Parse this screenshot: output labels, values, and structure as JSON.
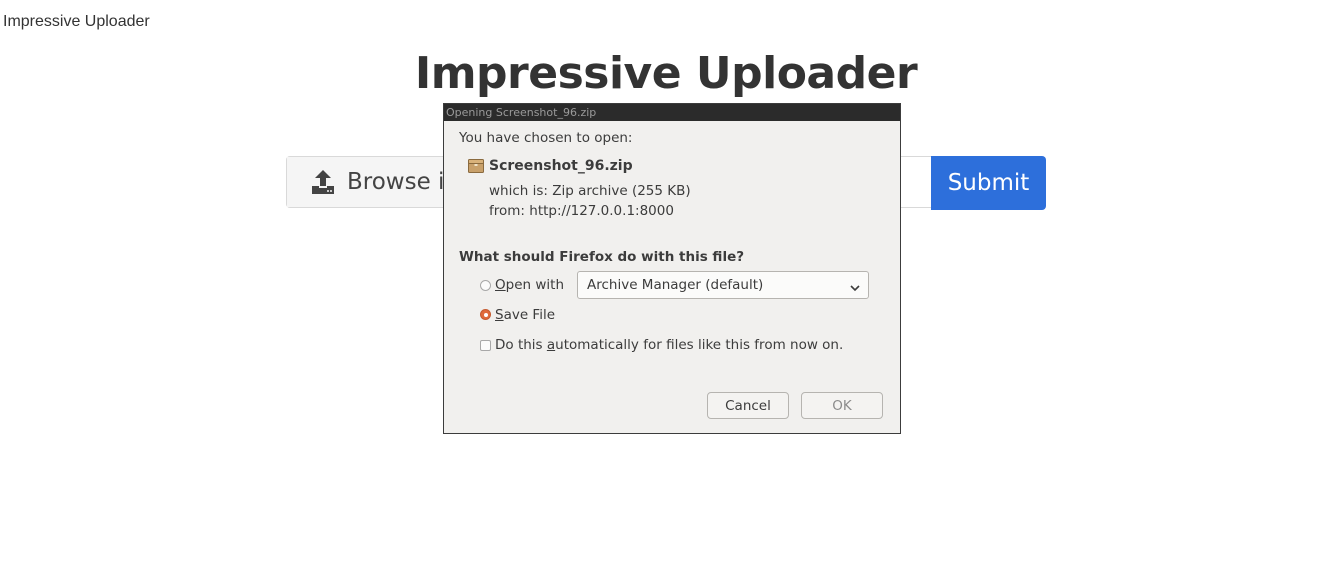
{
  "page": {
    "tab_title": "Impressive Uploader",
    "heading": "Impressive Uploader",
    "browse_label": "Browse i",
    "submit_label": "Submit"
  },
  "dialog": {
    "title": "Opening Screenshot_96.zip",
    "chosen_text": "You have chosen to open:",
    "file_name": "Screenshot_96.zip",
    "which_is_label": "which is:",
    "which_is_value": "Zip archive (255 KB)",
    "from_label": "from:",
    "from_value": "http://127.0.0.1:8000",
    "question": "What should Firefox do with this file?",
    "open_with_prefix": "O",
    "open_with_rest": "pen with",
    "open_with_app": "Archive Manager (default)",
    "save_prefix": "S",
    "save_rest": "ave File",
    "auto_before": "Do this ",
    "auto_underlined": "a",
    "auto_after": "utomatically for files like this from now on.",
    "cancel_label": "Cancel",
    "ok_label": "OK",
    "selected_option": "Save File"
  },
  "colors": {
    "submit_bg": "#2d6fdb",
    "radio_selected": "#e06a3b",
    "dialog_bg": "#f1f0ee",
    "titlebar_bg": "#2b2b2b"
  },
  "icons": {
    "upload": "upload-icon",
    "file": "archive-file-icon",
    "dropdown": "chevron-down-icon"
  }
}
